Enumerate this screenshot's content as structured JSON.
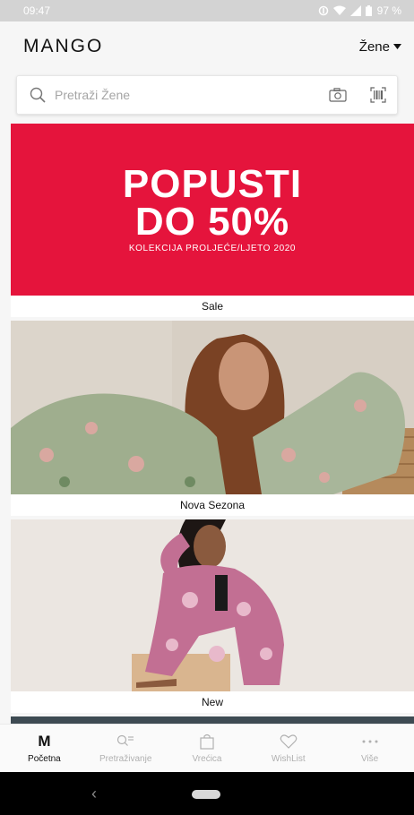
{
  "status_bar": {
    "time": "09:47",
    "battery": "97 %"
  },
  "header": {
    "logo": "MANGO",
    "gender_selector": "Žene"
  },
  "search": {
    "placeholder": "Pretraži Žene",
    "icons": [
      "search-icon",
      "camera-icon",
      "barcode-icon"
    ]
  },
  "promo": {
    "line1": "POPUSTI",
    "line2": "DO 50%",
    "subtitle": "KOLEKCIJA PROLJEĆE/LJETO 2020",
    "color": "#e5143c"
  },
  "sections": [
    {
      "caption": "Sale"
    },
    {
      "caption": "Nova Sezona"
    },
    {
      "caption": "New"
    }
  ],
  "bottom_nav": {
    "items": [
      {
        "label": "Početna",
        "icon": "mango-m-icon",
        "active": true
      },
      {
        "label": "Pretraživanje",
        "icon": "search-list-icon",
        "active": false
      },
      {
        "label": "Vrećica",
        "icon": "shopping-bag-icon",
        "active": false
      },
      {
        "label": "WishList",
        "icon": "heart-icon",
        "active": false
      },
      {
        "label": "Više",
        "icon": "more-dots-icon",
        "active": false
      }
    ]
  },
  "system_nav": {
    "icons": [
      "back-icon",
      "home-pill"
    ]
  }
}
